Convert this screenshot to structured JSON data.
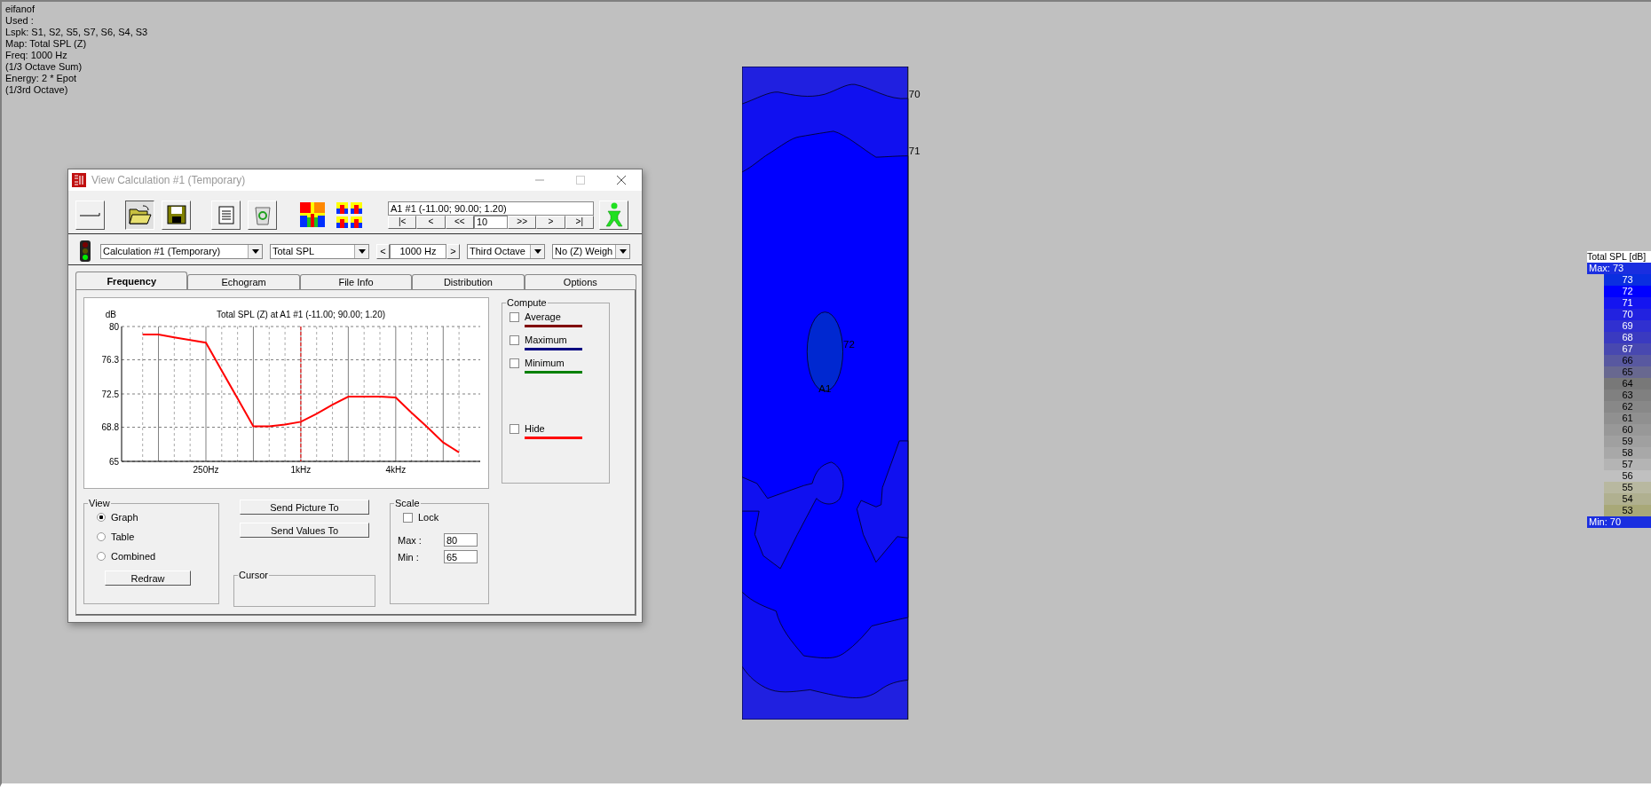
{
  "info_lines": [
    "eifanof",
    "Used :",
    "Lspk: S1, S2, S5, S7, S6, S4, S3",
    "Map: Total SPL (Z)",
    "Freq: 1000 Hz",
    "(1/3 Octave Sum)",
    "Energy: 2 * Epot",
    "(1/3rd Octave)"
  ],
  "dialog": {
    "title": "View Calculation #1 (Temporary)",
    "position_field": "A1 #1  (-11.00; 90.00; 1.20)",
    "nav_back": [
      "|<",
      "<",
      "<<"
    ],
    "step_value": "10",
    "nav_forward": [
      ">>",
      ">",
      ">|"
    ],
    "selectors": [
      {
        "kind": "combo",
        "value": "Calculation #1 (Temporary)"
      },
      {
        "kind": "combo",
        "value": "Total SPL"
      },
      {
        "kind": "stepper",
        "prev": "<",
        "value": "1000 Hz",
        "next": ">"
      },
      {
        "kind": "combo",
        "value": "Third Octave"
      },
      {
        "kind": "combo",
        "value": "No (Z) Weigh"
      }
    ],
    "tabs": [
      {
        "label": "Frequency",
        "selected": true
      },
      {
        "label": "Echogram",
        "selected": false
      },
      {
        "label": "File Info",
        "selected": false
      },
      {
        "label": "Distribution",
        "selected": false
      },
      {
        "label": "Options",
        "selected": false
      }
    ],
    "chart_data": {
      "type": "line",
      "title": "Total SPL (Z) at A1 #1  (-11.00; 90.00; 1.20)",
      "ylabel": "dB",
      "categories": [
        null,
        null,
        null,
        null,
        "250Hz",
        null,
        null,
        null,
        null,
        null,
        "1kHz",
        null,
        null,
        null,
        null,
        null,
        "4kHz",
        null,
        null,
        null,
        null
      ],
      "series": [
        {
          "color": "#ff0000",
          "values": [
            79.1,
            79.1,
            78.8,
            78.5,
            78.2,
            75.1,
            72.0,
            68.9,
            68.9,
            69.1,
            69.4,
            70.3,
            71.3,
            72.2,
            72.2,
            72.2,
            72.1,
            70.4,
            68.8,
            67.1,
            66.0
          ]
        }
      ],
      "ylim": [
        65,
        80
      ],
      "yticks": [
        65,
        68.8,
        72.5,
        76.3,
        80
      ],
      "grid": true
    },
    "compute": {
      "title": "Compute",
      "options": [
        {
          "label": "Average",
          "checked": false,
          "color": "#800000"
        },
        {
          "label": "Maximum",
          "checked": false,
          "color": "#000080"
        },
        {
          "label": "Minimum",
          "checked": false,
          "color": "#008000"
        },
        {
          "label": "Hide",
          "checked": false,
          "color": "#ff0000"
        }
      ]
    },
    "view": {
      "title": "View",
      "options": [
        {
          "label": "Graph",
          "selected": true
        },
        {
          "label": "Table",
          "selected": false
        },
        {
          "label": "Combined",
          "selected": false
        }
      ],
      "redraw": "Redraw"
    },
    "send_buttons": [
      "Send Picture To",
      "Send Values To"
    ],
    "cursor": {
      "title": "Cursor"
    },
    "scale": {
      "title": "Scale",
      "lock": {
        "label": "Lock",
        "checked": false
      },
      "max_label": "Max :",
      "max": "80",
      "min_label": "Min :",
      "min": "65"
    }
  },
  "map": {
    "edge_labels": [
      "70",
      "71"
    ],
    "inner_label": "72",
    "point_label": "A1"
  },
  "legend": {
    "title": "Total SPL [dB]",
    "max": "Max:  73",
    "min": "Min:  70",
    "entries": [
      {
        "label": "73",
        "color": "#0a2ee0"
      },
      {
        "label": "72",
        "color": "#0000ff"
      },
      {
        "label": "71",
        "color": "#1414f0"
      },
      {
        "label": "70",
        "color": "#2222e0"
      },
      {
        "label": "69",
        "color": "#3030d0"
      },
      {
        "label": "68",
        "color": "#3a3ac0"
      },
      {
        "label": "67",
        "color": "#4848b0"
      },
      {
        "label": "66",
        "color": "#5858a0"
      },
      {
        "label": "65",
        "color": "#686890"
      },
      {
        "label": "64",
        "color": "#787878"
      },
      {
        "label": "63",
        "color": "#808080"
      },
      {
        "label": "62",
        "color": "#888888"
      },
      {
        "label": "61",
        "color": "#909090"
      },
      {
        "label": "60",
        "color": "#989898"
      },
      {
        "label": "59",
        "color": "#a0a0a0"
      },
      {
        "label": "58",
        "color": "#a8a8a8"
      },
      {
        "label": "57",
        "color": "#b4b4b4"
      },
      {
        "label": "56",
        "color": "#c0c0c0"
      },
      {
        "label": "55",
        "color": "#b8b8a0"
      },
      {
        "label": "54",
        "color": "#b0b090"
      },
      {
        "label": "53",
        "color": "#a8a878"
      }
    ]
  }
}
